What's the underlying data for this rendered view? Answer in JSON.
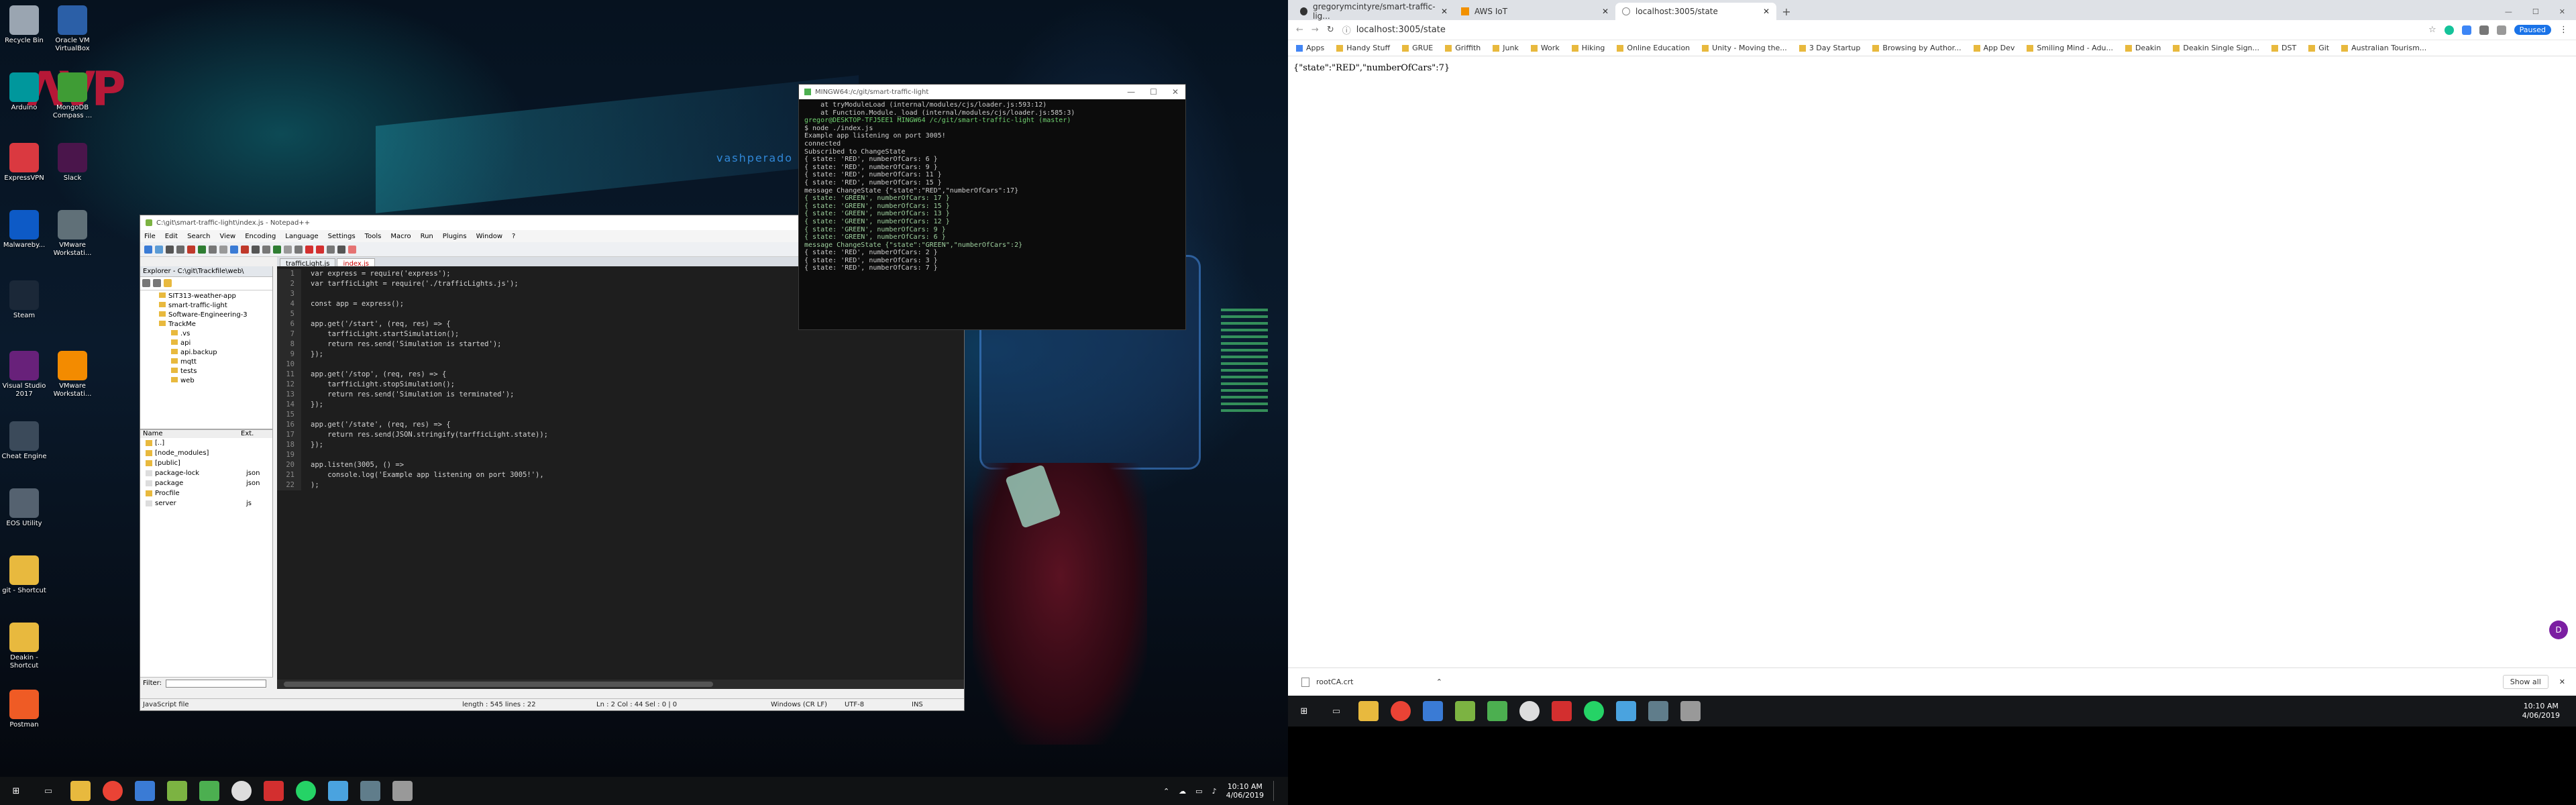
{
  "desktop_icons": [
    {
      "label": "Recycle Bin",
      "icon": "recycle-bin-icon",
      "color": "#9aa5b1"
    },
    {
      "label": "Oracle VM VirtualBox",
      "icon": "virtualbox-icon",
      "color": "#2b5fa7"
    },
    {
      "label": "Arduino",
      "icon": "arduino-icon",
      "color": "#00979c"
    },
    {
      "label": "MongoDB Compass ...",
      "icon": "mongodb-icon",
      "color": "#3f9c35"
    },
    {
      "label": "ExpressVPN",
      "icon": "expressvpn-icon",
      "color": "#da3940"
    },
    {
      "label": "Slack",
      "icon": "slack-icon",
      "color": "#4a154b"
    },
    {
      "label": "Malwareby...",
      "icon": "malwarebytes-icon",
      "color": "#0d5ac6"
    },
    {
      "label": "VMware Workstati...",
      "icon": "vmware-icon",
      "color": "#607078"
    },
    {
      "label": "Steam",
      "icon": "steam-icon",
      "color": "#1b2838"
    },
    {
      "label": "Visual Studio 2017",
      "icon": "visual-studio-icon",
      "color": "#68217a"
    },
    {
      "label": "VMware Workstati...",
      "icon": "vmware-icon",
      "color": "#f38b00"
    },
    {
      "label": "Cheat Engine",
      "icon": "cheat-engine-icon",
      "color": "#3b4a5a"
    },
    {
      "label": "EOS Utility",
      "icon": "eos-utility-icon",
      "color": "#556270"
    },
    {
      "label": "git - Shortcut",
      "icon": "folder-icon",
      "color": "#e8b93e"
    },
    {
      "label": "Deakin - Shortcut",
      "icon": "folder-icon",
      "color": "#e8b93e"
    },
    {
      "label": "Postman",
      "icon": "postman-icon",
      "color": "#ef5b25"
    }
  ],
  "notepad": {
    "title": "C:\\git\\smart-traffic-light\\index.js - Notepad++",
    "menu": [
      "File",
      "Edit",
      "Search",
      "View",
      "Encoding",
      "Language",
      "Settings",
      "Tools",
      "Macro",
      "Run",
      "Plugins",
      "Window",
      "?"
    ],
    "explorer_title": "Explorer - C:\\git\\Trackfile\\web\\",
    "tree": [
      "SIT313-weather-app",
      "smart-traffic-light",
      "Software-Engineering-3",
      "TrackMe",
      ".vs",
      "api",
      "api.backup",
      "mqtt",
      "tests",
      "web"
    ],
    "list_headers": [
      "Name",
      "Ext."
    ],
    "files": [
      [
        "[..]",
        ""
      ],
      [
        "[node_modules]",
        ""
      ],
      [
        "[public]",
        ""
      ],
      [
        "package-lock",
        "json"
      ],
      [
        "package",
        "json"
      ],
      [
        "Procfile",
        ""
      ],
      [
        "server",
        "js"
      ]
    ],
    "filter_label": "Filter:",
    "tabs": [
      "trafficLight.js",
      "index.js"
    ],
    "code": [
      "var express = require('express');",
      "var tarfficLight = require('./trafficLights.js');",
      "",
      "const app = express();",
      "",
      "app.get('/start', (req, res) => {",
      "    tarfficLight.startSimulation();",
      "    return res.send('Simulation is started');",
      "});",
      "",
      "app.get('/stop', (req, res) => {",
      "    tarfficLight.stopSimulation();",
      "    return res.send('Simulation is terminated');",
      "});",
      "",
      "app.get('/state', (req, res) => {",
      "    return res.send(JSON.stringify(tarfficLight.state));",
      "});",
      "",
      "app.listen(3005, () =>",
      "    console.log('Example app listening on port 3005!'),",
      ");"
    ],
    "status": {
      "type": "JavaScript file",
      "length": "length : 545   lines : 22",
      "pos": "Ln : 2    Col : 44    Sel : 0 | 0",
      "eol": "Windows (CR LF)",
      "enc": "UTF-8",
      "ins": "INS"
    }
  },
  "cmd": {
    "title": "MINGW64:/c/git/smart-traffic-light",
    "lines": [
      "    at tryModuleLoad (internal/modules/cjs/loader.js:593:12)",
      "    at Function.Module._load (internal/modules/cjs/loader.js:585:3)",
      "",
      "gregor@DESKTOP-TFJ5EE1 MINGW64 /c/git/smart-traffic-light (master)",
      "$ node ./index.js",
      "Example app listening on port 3005!",
      "connected",
      "Subscribed to ChangeState",
      "{ state: 'RED', numberOfCars: 6 }",
      "{ state: 'RED', numberOfCars: 9 }",
      "{ state: 'RED', numberOfCars: 11 }",
      "{ state: 'RED', numberOfCars: 15 }",
      "message ChangeState {\"state\":\"RED\",\"numberOfCars\":17}",
      "{ state: 'GREEN', numberOfCars: 17 }",
      "{ state: 'GREEN', numberOfCars: 15 }",
      "{ state: 'GREEN', numberOfCars: 13 }",
      "{ state: 'GREEN', numberOfCars: 12 }",
      "{ state: 'GREEN', numberOfCars: 9 }",
      "{ state: 'GREEN', numberOfCars: 6 }",
      "message ChangeState {\"state\":\"GREEN\",\"numberOfCars\":2}",
      "{ state: 'RED', numberOfCars: 2 }",
      "{ state: 'RED', numberOfCars: 3 }",
      "{ state: 'RED', numberOfCars: 7 }"
    ]
  },
  "taskbar_left": {
    "time": "10:10 AM",
    "date": "4/06/2019"
  },
  "chrome": {
    "tabs": [
      "gregorymcintyre/smart-traffic-lig...",
      "AWS IoT",
      "localhost:3005/state"
    ],
    "url": "localhost:3005/state",
    "paused": "Paused",
    "bookmarks": [
      "Apps",
      "Handy Stuff",
      "GRUE",
      "Griffith",
      "Junk",
      "Work",
      "Hiking",
      "Online Education",
      "Unity - Moving the...",
      "3 Day Startup",
      "Browsing by Author...",
      "App Dev",
      "Smiling Mind - Adu...",
      "Deakin",
      "Deakin Single Sign...",
      "DST",
      "Git",
      "Australian Tourism..."
    ],
    "body": "{\"state\":\"RED\",\"numberOfCars\":7}",
    "download": "rootCA.crt",
    "show_all": "Show all",
    "avatar": "D",
    "time": "10:10 AM",
    "date": "4/06/2019"
  }
}
